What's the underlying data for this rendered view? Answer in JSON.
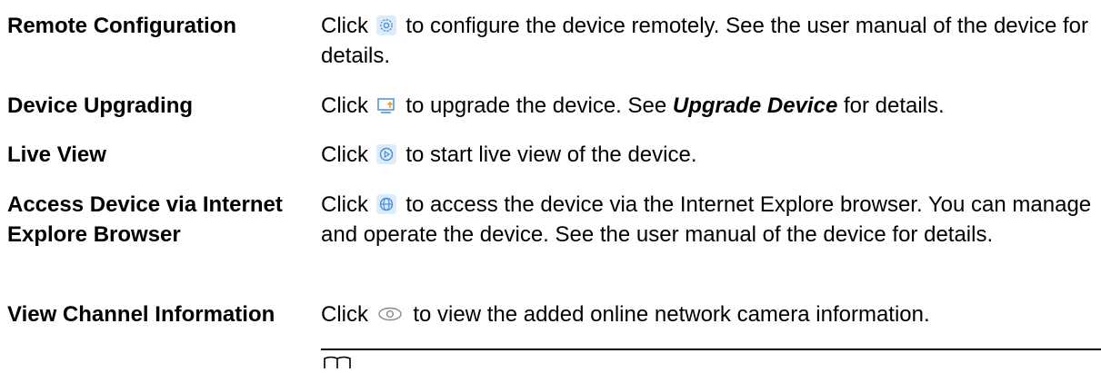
{
  "rows": [
    {
      "term": "Remote Configuration",
      "before": "Click",
      "icon": "gear-icon",
      "after": "to configure the device remotely. See the user manual of the device for details."
    },
    {
      "term": "Device Upgrading",
      "before": "Click",
      "icon": "upgrade-monitor-icon",
      "after_a": "to upgrade the device. See ",
      "link": "Upgrade Device",
      "after_b": " for details."
    },
    {
      "term": "Live View",
      "before": "Click",
      "icon": "play-circle-icon",
      "after": "to start live view of the device."
    },
    {
      "term": "Access Device via Internet Explore Browser",
      "before": "Click",
      "icon": "globe-icon",
      "after": "to access the device via the Internet Explore browser. You can manage and operate the device. See the user manual of the device for details."
    },
    {
      "term": "View Channel Information",
      "before": "Click",
      "icon": "eye-icon",
      "after": "to view the added online network camera information."
    }
  ],
  "colors": {
    "icon_blue": "#4a8fd8",
    "icon_bg": "#dcecfb",
    "text": "#000000"
  }
}
